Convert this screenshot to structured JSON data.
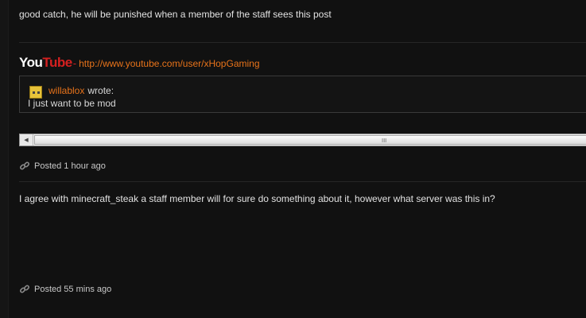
{
  "posts": [
    {
      "body": "good catch, he will be punished when a member of the staff sees this post",
      "signature": {
        "logo_you": "You",
        "logo_tube": "Tube",
        "dash": "-",
        "url": "http://www.youtube.com/user/xHopGaming"
      },
      "quote": {
        "author": "willablox",
        "wrote": "wrote:",
        "text": "I just want to be mod"
      },
      "posted": "Posted 1 hour ago"
    },
    {
      "body": "I agree with minecraft_steak a staff member will for sure do something about it, however what server was this in?",
      "posted": "Posted 55 mins ago"
    }
  ],
  "scrollbar": {
    "left_arrow": "◀",
    "grip": "III"
  },
  "icons": {
    "permalink": "link-icon",
    "avatar": "pixel-avatar"
  },
  "colors": {
    "background": "#111111",
    "link": "#e8731a",
    "youtube_red": "#d42020"
  }
}
